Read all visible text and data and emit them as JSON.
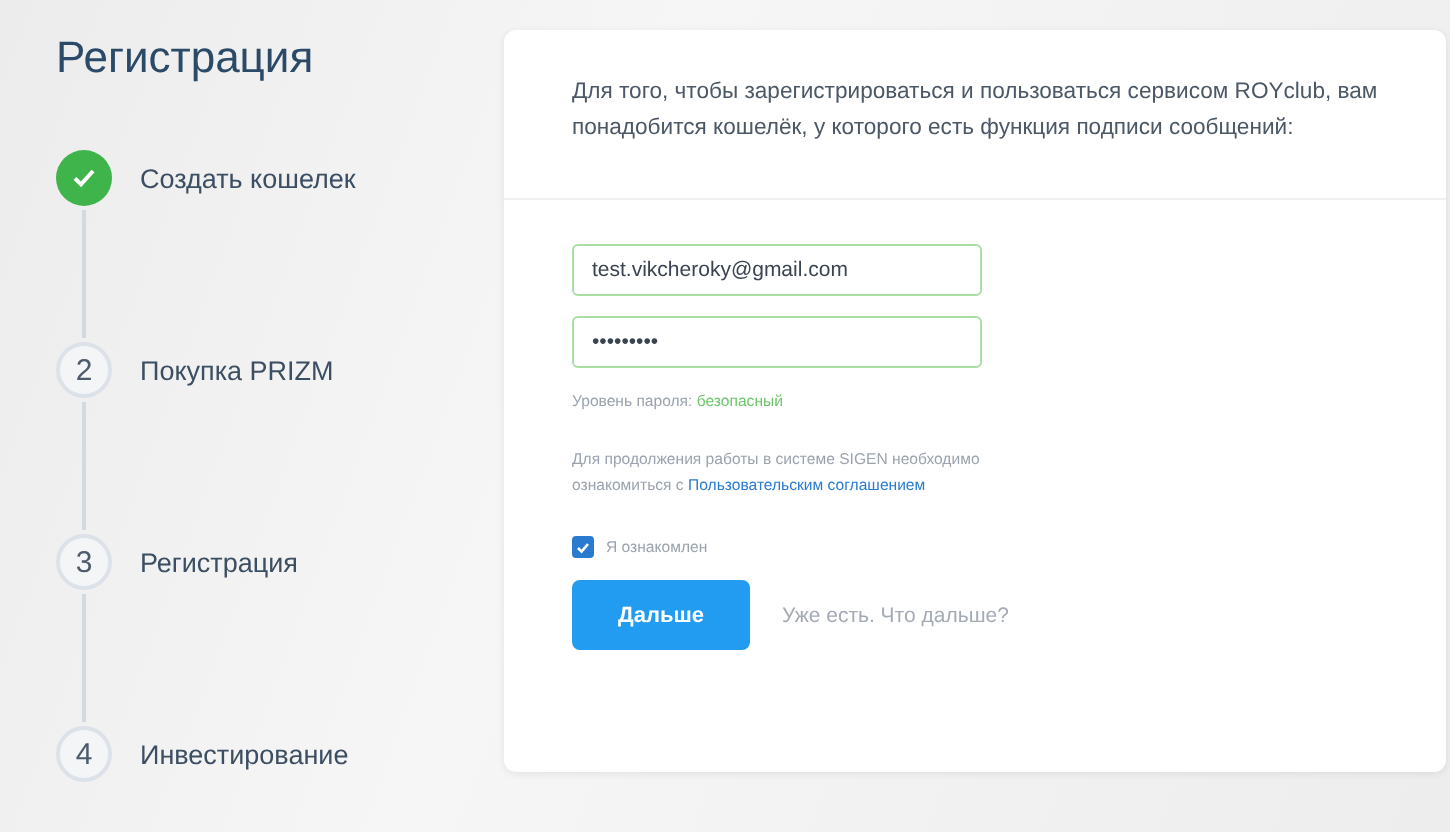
{
  "title": "Регистрация",
  "steps": [
    {
      "label": "Создать кошелек",
      "done": true
    },
    {
      "number": "2",
      "label": "Покупка PRIZM",
      "done": false
    },
    {
      "number": "3",
      "label": "Регистрация",
      "done": false
    },
    {
      "number": "4",
      "label": "Инвестирование",
      "done": false
    }
  ],
  "card": {
    "intro": "Для того, чтобы зарегистрироваться и пользоваться сервисом ROYclub, вам понадобится кошелёк, у которого есть функция подписи сообщений:",
    "email": {
      "value": "test.vikcheroky@gmail.com"
    },
    "password": {
      "value": "•••••••••"
    },
    "strength": {
      "label": "Уровень пароля:",
      "value": "безопасный"
    },
    "agreement": {
      "text": "Для продолжения работы в системе SIGEN необходимо ознакомиться с",
      "link": "Пользовательским соглашением"
    },
    "consent": {
      "label": "Я ознакомлен",
      "checked": true
    },
    "button": "Дальше",
    "link": "Уже есть. Что дальше?"
  }
}
